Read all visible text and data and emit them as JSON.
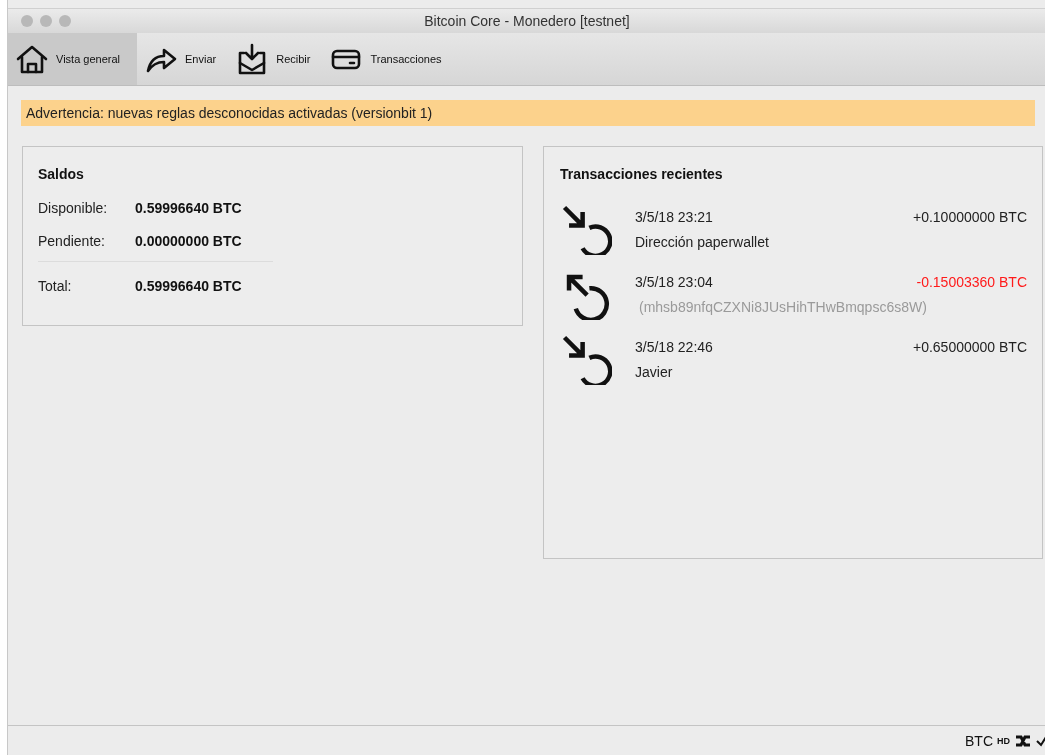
{
  "window": {
    "title": "Bitcoin Core - Monedero [testnet]"
  },
  "tabs": [
    {
      "label": "Vista general",
      "kind": "home",
      "selected": true
    },
    {
      "label": "Enviar",
      "kind": "send",
      "selected": false
    },
    {
      "label": "Recibir",
      "kind": "receive",
      "selected": false
    },
    {
      "label": "Transacciones",
      "kind": "card",
      "selected": false
    }
  ],
  "warning": "Advertencia: nuevas reglas desconocidas activadas (versionbit 1)",
  "balances": {
    "title": "Saldos",
    "rows": [
      {
        "label": "Disponible:",
        "value": "0.59996640 BTC",
        "divider_above": false
      },
      {
        "label": "Pendiente:",
        "value": "0.00000000 BTC",
        "divider_above": false
      },
      {
        "label": "Total:",
        "value": "0.59996640 BTC",
        "divider_above": true
      }
    ]
  },
  "recent": {
    "title": "Transacciones recientes",
    "items": [
      {
        "kind": "incoming",
        "date": "3/5/18 23:21",
        "amount": "+0.10000000 BTC",
        "label": "Dirección paperwallet"
      },
      {
        "kind": "outgoing",
        "date": "3/5/18 23:04",
        "amount": "-0.15003360 BTC",
        "address": "(mhsb89nfqCZXNi8JUsHihTHwBmqpsc6s8W)"
      },
      {
        "kind": "incoming",
        "date": "3/5/18 22:46",
        "amount": "+0.65000000 BTC",
        "label": "Javier"
      }
    ]
  },
  "status_bar": {
    "unit": "BTC",
    "hd": "HD"
  }
}
